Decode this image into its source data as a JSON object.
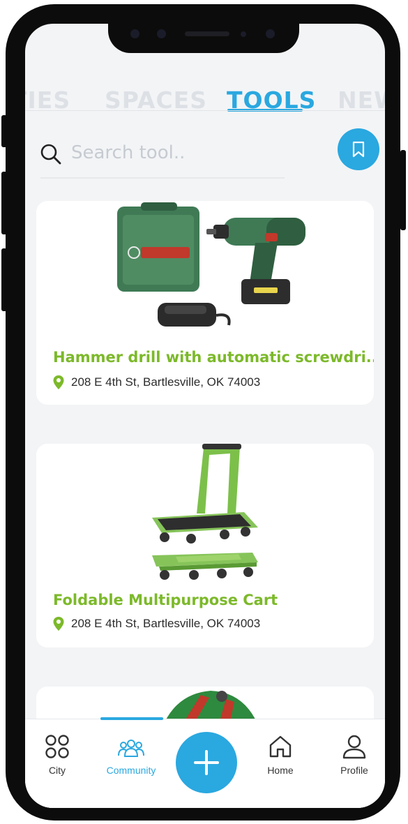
{
  "tabs": [
    {
      "label": "TIES"
    },
    {
      "label": "SPACES"
    },
    {
      "label": "TOOLS",
      "active": true
    },
    {
      "label": "NEW"
    }
  ],
  "search": {
    "placeholder": "Search tool.."
  },
  "items": [
    {
      "title": "Hammer drill with automatic screwdri...",
      "address": "208 E 4th St, Bartlesville, OK 74003",
      "image": "hammer-drill-photo"
    },
    {
      "title": "Foldable Multipurpose Cart",
      "address": "208 E 4th St, Bartlesville, OK 74003",
      "image": "foldable-cart-photo"
    },
    {
      "title": "",
      "address": "",
      "image": "partial-tool-photo"
    }
  ],
  "nav": {
    "city": "City",
    "community": "Community",
    "home": "Home",
    "profile": "Profile",
    "active": "community"
  },
  "colors": {
    "accent": "#2aa8e0",
    "title_green": "#7cb92a",
    "background": "#f3f4f6"
  },
  "icons": [
    "search-icon",
    "bookmark-icon",
    "location-pin-icon",
    "city-icon",
    "community-icon",
    "plus-icon",
    "home-icon",
    "profile-icon"
  ]
}
